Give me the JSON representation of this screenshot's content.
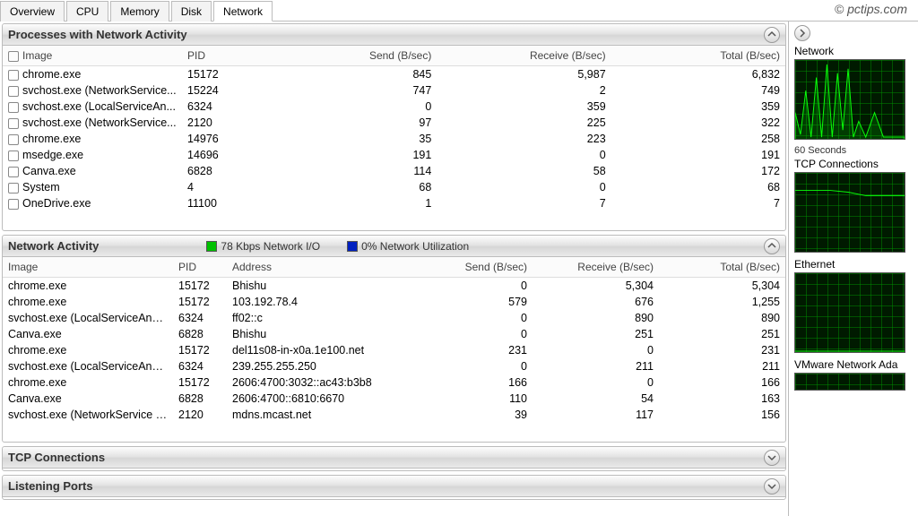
{
  "watermark": "© pctips.com",
  "tabs": [
    "Overview",
    "CPU",
    "Memory",
    "Disk",
    "Network"
  ],
  "active_tab": "Network",
  "panel1": {
    "title": "Processes with Network Activity",
    "columns": [
      "Image",
      "PID",
      "Send (B/sec)",
      "Receive (B/sec)",
      "Total (B/sec)"
    ],
    "rows": [
      {
        "image": "chrome.exe",
        "pid": "15172",
        "send": "845",
        "recv": "5,987",
        "total": "6,832"
      },
      {
        "image": "svchost.exe (NetworkService...",
        "pid": "15224",
        "send": "747",
        "recv": "2",
        "total": "749"
      },
      {
        "image": "svchost.exe (LocalServiceAn...",
        "pid": "6324",
        "send": "0",
        "recv": "359",
        "total": "359"
      },
      {
        "image": "svchost.exe (NetworkService...",
        "pid": "2120",
        "send": "97",
        "recv": "225",
        "total": "322"
      },
      {
        "image": "chrome.exe",
        "pid": "14976",
        "send": "35",
        "recv": "223",
        "total": "258"
      },
      {
        "image": "msedge.exe",
        "pid": "14696",
        "send": "191",
        "recv": "0",
        "total": "191"
      },
      {
        "image": "Canva.exe",
        "pid": "6828",
        "send": "114",
        "recv": "58",
        "total": "172"
      },
      {
        "image": "System",
        "pid": "4",
        "send": "68",
        "recv": "0",
        "total": "68"
      },
      {
        "image": "OneDrive.exe",
        "pid": "11100",
        "send": "1",
        "recv": "7",
        "total": "7"
      }
    ]
  },
  "panel2": {
    "title": "Network Activity",
    "legend1_color": "#00c000",
    "legend1_text": "78 Kbps Network I/O",
    "legend2_color": "#0020c0",
    "legend2_text": "0% Network Utilization",
    "columns": [
      "Image",
      "PID",
      "Address",
      "Send (B/sec)",
      "Receive (B/sec)",
      "Total (B/sec)"
    ],
    "rows": [
      {
        "image": "chrome.exe",
        "pid": "15172",
        "addr": "Bhishu",
        "send": "0",
        "recv": "5,304",
        "total": "5,304"
      },
      {
        "image": "chrome.exe",
        "pid": "15172",
        "addr": "103.192.78.4",
        "send": "579",
        "recv": "676",
        "total": "1,255"
      },
      {
        "image": "svchost.exe (LocalServiceAndNo...",
        "pid": "6324",
        "addr": "ff02::c",
        "send": "0",
        "recv": "890",
        "total": "890"
      },
      {
        "image": "Canva.exe",
        "pid": "6828",
        "addr": "Bhishu",
        "send": "0",
        "recv": "251",
        "total": "251"
      },
      {
        "image": "chrome.exe",
        "pid": "15172",
        "addr": "del11s08-in-x0a.1e100.net",
        "send": "231",
        "recv": "0",
        "total": "231"
      },
      {
        "image": "svchost.exe (LocalServiceAndNo...",
        "pid": "6324",
        "addr": "239.255.255.250",
        "send": "0",
        "recv": "211",
        "total": "211"
      },
      {
        "image": "chrome.exe",
        "pid": "15172",
        "addr": "2606:4700:3032::ac43:b3b8",
        "send": "166",
        "recv": "0",
        "total": "166"
      },
      {
        "image": "Canva.exe",
        "pid": "6828",
        "addr": "2606:4700::6810:6670",
        "send": "110",
        "recv": "54",
        "total": "163"
      },
      {
        "image": "svchost.exe (NetworkService -p)",
        "pid": "2120",
        "addr": "mdns.mcast.net",
        "send": "39",
        "recv": "117",
        "total": "156"
      }
    ]
  },
  "panel3": {
    "title": "TCP Connections"
  },
  "panel4": {
    "title": "Listening Ports"
  },
  "sidebar": {
    "graphs": [
      {
        "title": "Network",
        "caption": "60 Seconds"
      },
      {
        "title": "TCP Connections",
        "caption": ""
      },
      {
        "title": "Ethernet",
        "caption": ""
      },
      {
        "title": "VMware Network Ada",
        "caption": ""
      }
    ]
  }
}
